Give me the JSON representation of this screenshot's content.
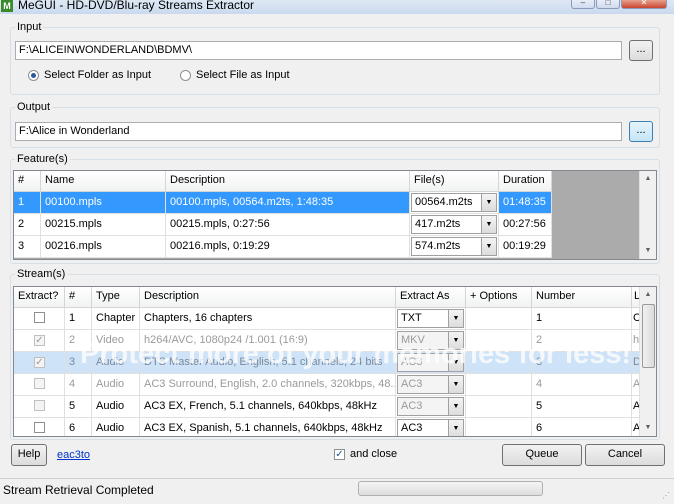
{
  "window": {
    "title": "MeGUI - HD-DVD/Blu-ray Streams Extractor",
    "app_icon": "M"
  },
  "input": {
    "legend": "Input",
    "path": "F:\\ALICEINWONDERLAND\\BDMV\\",
    "browse": "...",
    "opt_folder": "Select Folder as Input",
    "opt_file": "Select File as Input",
    "selected": "folder"
  },
  "output": {
    "legend": "Output",
    "path": "F:\\Alice in Wonderland",
    "browse": "..."
  },
  "features": {
    "legend": "Feature(s)",
    "headers": [
      "#",
      "Name",
      "Description",
      "File(s)",
      "Duration"
    ],
    "rows": [
      {
        "num": "1",
        "name": "00100.mpls",
        "desc": "00100.mpls, 00564.m2ts, 1:48:35",
        "file": "00564.m2ts",
        "duration": "01:48:35"
      },
      {
        "num": "2",
        "name": "00215.mpls",
        "desc": "00215.mpls, 0:27:56",
        "file": "417.m2ts",
        "duration": "00:27:56"
      },
      {
        "num": "3",
        "name": "00216.mpls",
        "desc": "00216.mpls, 0:19:29",
        "file": "574.m2ts",
        "duration": "00:19:29"
      }
    ]
  },
  "streams": {
    "legend": "Stream(s)",
    "headers": [
      "Extract?",
      "#",
      "Type",
      "Description",
      "Extract As",
      "+ Options",
      "Number",
      "L"
    ],
    "rows": [
      {
        "num": "1",
        "type": "Chapter",
        "desc": "Chapters, 16 chapters",
        "as": "TXT",
        "number": "1",
        "lang": "C"
      },
      {
        "num": "2",
        "type": "Video",
        "desc": "h264/AVC, 1080p24 /1.001 (16:9)",
        "as": "MKV",
        "number": "2",
        "lang": "h"
      },
      {
        "num": "3",
        "type": "Audio",
        "desc": "DTS Master Audio, English, 5.1 channels, 24 bits",
        "as": "AC3",
        "number": "3",
        "lang": "D"
      },
      {
        "num": "4",
        "type": "Audio",
        "desc": "AC3 Surround, English, 2.0 channels, 320kbps, 48...",
        "as": "AC3",
        "number": "4",
        "lang": "A"
      },
      {
        "num": "5",
        "type": "Audio",
        "desc": "AC3 EX, French, 5.1 channels, 640kbps, 48kHz",
        "as": "AC3",
        "number": "5",
        "lang": "A"
      },
      {
        "num": "6",
        "type": "Audio",
        "desc": "AC3 EX, Spanish, 5.1 channels, 640kbps, 48kHz",
        "as": "AC3",
        "number": "6",
        "lang": "A"
      }
    ]
  },
  "bottom": {
    "help": "Help",
    "link": "eac3to",
    "and_close": "and close",
    "queue": "Queue",
    "cancel": "Cancel"
  },
  "status": {
    "text": "Stream Retrieval Completed"
  },
  "watermark": "Protect more of your memories for less!"
}
